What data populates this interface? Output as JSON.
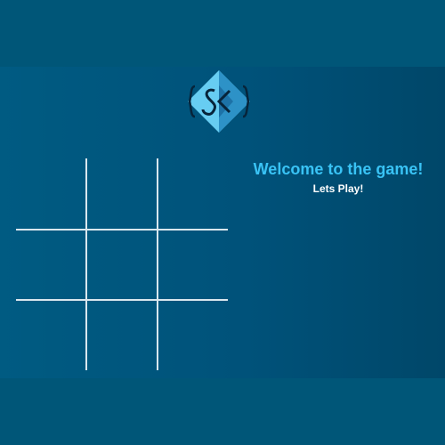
{
  "app": {
    "logo": {
      "icon": "sk-logo-icon",
      "text": "SK",
      "colors": {
        "light": "#67cdf2",
        "dark": "#2a8ec4",
        "outline": "#07243a"
      }
    }
  },
  "game": {
    "welcome_text": "Welcome to the game!",
    "subtitle_text": "Lets Play!",
    "board": {
      "rows": 3,
      "cols": 3,
      "cells": [
        "",
        "",
        "",
        "",
        "",
        "",
        "",
        "",
        ""
      ]
    }
  },
  "colors": {
    "background": "#005577",
    "grid_line": "#d9e7ee",
    "accent": "#39c3f5",
    "text_white": "#ffffff"
  }
}
